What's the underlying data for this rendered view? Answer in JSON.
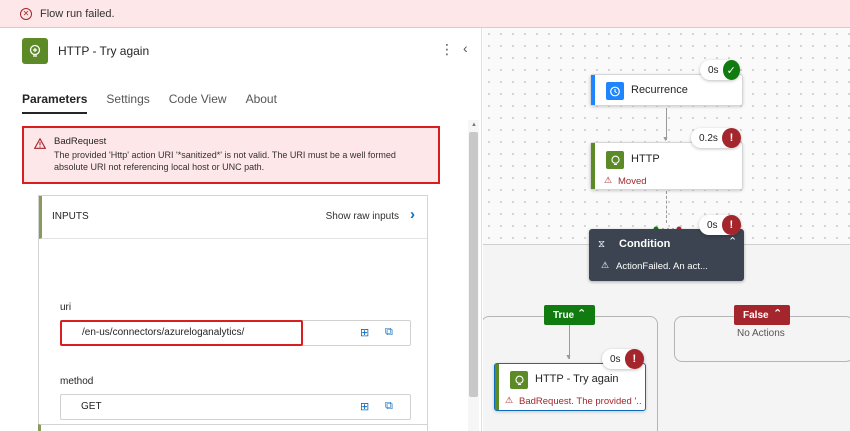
{
  "banner": {
    "text": "Flow run failed."
  },
  "panel": {
    "title": "HTTP - Try again",
    "tabs": [
      "Parameters",
      "Settings",
      "Code View",
      "About"
    ],
    "error": {
      "title": "BadRequest",
      "message": "The provided 'Http' action URI '*sanitized*' is not valid. The URI must be a well formed absolute URI not referencing local host or UNC path."
    },
    "inputs": {
      "header": "INPUTS",
      "raw_link": "Show raw inputs",
      "uri_label": "uri",
      "uri_value": "/en-us/connectors/azureloganalytics/",
      "method_label": "method",
      "method_value": "GET"
    }
  },
  "canvas": {
    "recurrence": {
      "title": "Recurrence",
      "duration": "0s"
    },
    "http": {
      "title": "HTTP",
      "duration": "0.2s",
      "sub": "Moved"
    },
    "condition": {
      "title": "Condition",
      "duration": "0s",
      "sub": "ActionFailed. An act..."
    },
    "true_branch": "True",
    "false_branch": "False",
    "no_actions": "No Actions",
    "http_retry": {
      "title": "HTTP - Try again",
      "duration": "0s",
      "sub": "BadRequest. The provided '..."
    }
  },
  "colors": {
    "error_red": "#d81e1e",
    "success_green": "#107c10",
    "failed_red": "#a4262c",
    "http_green": "#5c8a26",
    "link_blue": "#0f6cbd",
    "condition_dark": "#3b4450"
  }
}
